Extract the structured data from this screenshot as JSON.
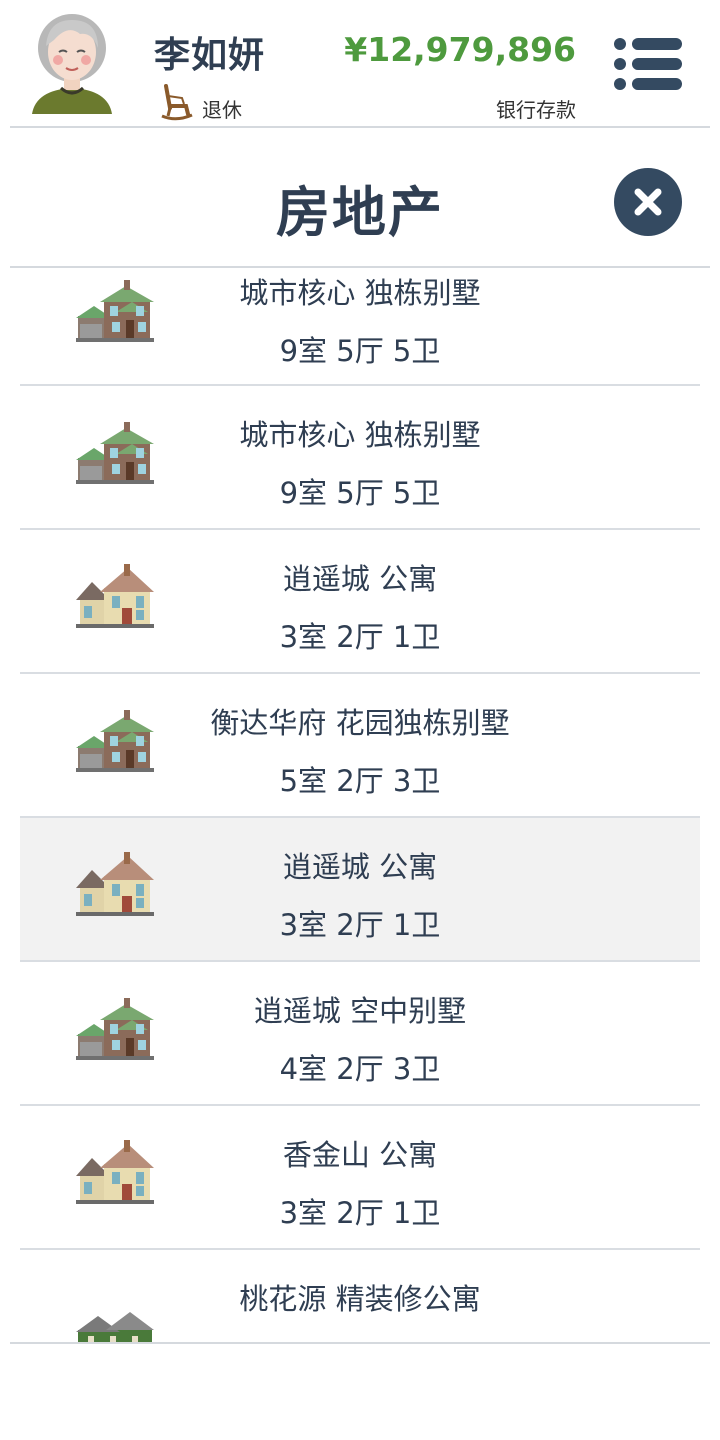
{
  "header": {
    "player_name": "李如妍",
    "status": "退休",
    "balance": "¥12,979,896",
    "balance_label": "银行存款",
    "avatar_icon": "elderly-woman-avatar-icon",
    "status_icon": "rocking-chair-icon",
    "menu_icon": "menu-list-icon"
  },
  "page": {
    "title": "房地产",
    "close_icon": "close-icon"
  },
  "colors": {
    "text": "#2f3e52",
    "money": "#4e9a3e",
    "close_bg": "#344a61",
    "divider": "#d9dde2",
    "selected_bg": "#f2f2f2"
  },
  "properties": [
    {
      "name": "城市核心 独栋别墅",
      "rooms": "9室 5厅 5卫",
      "icon": "villa-icon",
      "selected": false
    },
    {
      "name": "城市核心 独栋别墅",
      "rooms": "9室 5厅 5卫",
      "icon": "villa-icon",
      "selected": false
    },
    {
      "name": "逍遥城 公寓",
      "rooms": "3室 2厅 1卫",
      "icon": "house-icon",
      "selected": false
    },
    {
      "name": "衡达华府 花园独栋别墅",
      "rooms": "5室 2厅 3卫",
      "icon": "villa-icon",
      "selected": false
    },
    {
      "name": "逍遥城 公寓",
      "rooms": "3室 2厅 1卫",
      "icon": "house-icon",
      "selected": true
    },
    {
      "name": "逍遥城 空中别墅",
      "rooms": "4室 2厅 3卫",
      "icon": "villa-icon",
      "selected": false
    },
    {
      "name": "香金山 公寓",
      "rooms": "3室 2厅 1卫",
      "icon": "house-icon",
      "selected": false
    },
    {
      "name": "桃花源 精装修公寓",
      "rooms": "",
      "icon": "green-house-icon",
      "selected": false
    }
  ]
}
